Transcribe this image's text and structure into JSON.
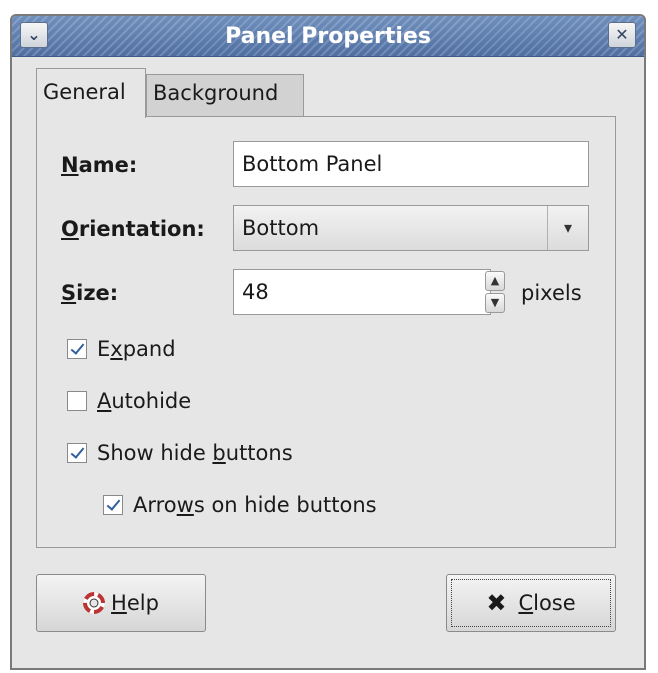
{
  "window": {
    "title": "Panel Properties",
    "menu_icon": "chevron-down-icon",
    "close_icon": "close-icon"
  },
  "tabs": [
    {
      "label": "General",
      "active": true
    },
    {
      "label": "Background",
      "active": false
    }
  ],
  "form": {
    "name_label": "Name:",
    "name_value": "Bottom Panel",
    "orientation_label": "Orientation:",
    "orientation_value": "Bottom",
    "size_label": "Size:",
    "size_value": "48",
    "size_unit": "pixels"
  },
  "checkboxes": [
    {
      "label": "Expand",
      "checked": true
    },
    {
      "label": "Autohide",
      "checked": false
    },
    {
      "label": "Show hide buttons",
      "checked": true
    },
    {
      "label": "Arrows on hide buttons",
      "checked": true
    }
  ],
  "buttons": {
    "help": "Help",
    "close": "Close"
  },
  "colors": {
    "titlebar": "#5a7aae",
    "check": "#2f5fa0"
  }
}
